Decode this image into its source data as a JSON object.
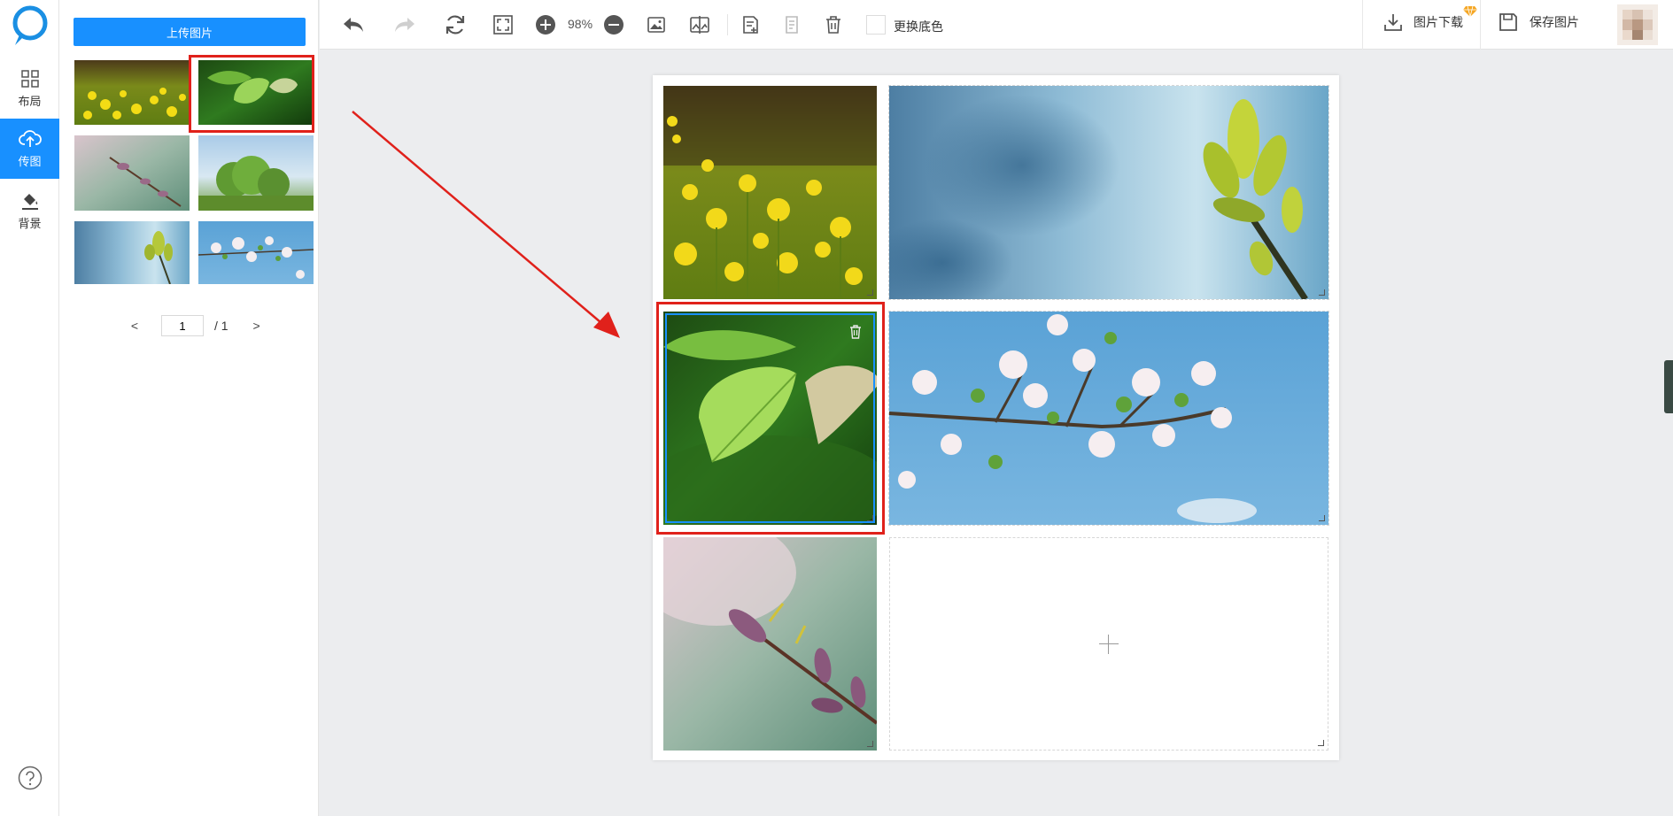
{
  "rail": {
    "items": [
      {
        "label": "布局",
        "icon": "layout-grid-icon"
      },
      {
        "label": "传图",
        "icon": "cloud-upload-icon"
      },
      {
        "label": "背景",
        "icon": "paint-bucket-icon"
      }
    ],
    "active_index": 1
  },
  "panel": {
    "upload_label": "上传图片",
    "thumbnails": [
      "rapeseed-flowers",
      "green-leaves",
      "willow-catkins",
      "tree-sky",
      "leaf-buds",
      "apple-blossoms"
    ],
    "selected_thumbnail_index": 1,
    "pager": {
      "current": "1",
      "total": "/ 1"
    }
  },
  "toolbar": {
    "zoom": "98%",
    "bg_color_label": "更换底色",
    "download_label": "图片下载",
    "save_label": "保存图片"
  },
  "canvas": {
    "cells": [
      "rapeseed-flowers",
      "leaf-buds",
      "green-leaves",
      "apple-blossoms",
      "willow-catkins",
      "empty"
    ],
    "selected_cell_index": 2
  },
  "colors": {
    "accent": "#1890ff",
    "highlight": "#e0211b",
    "vip": "#f5a623"
  }
}
